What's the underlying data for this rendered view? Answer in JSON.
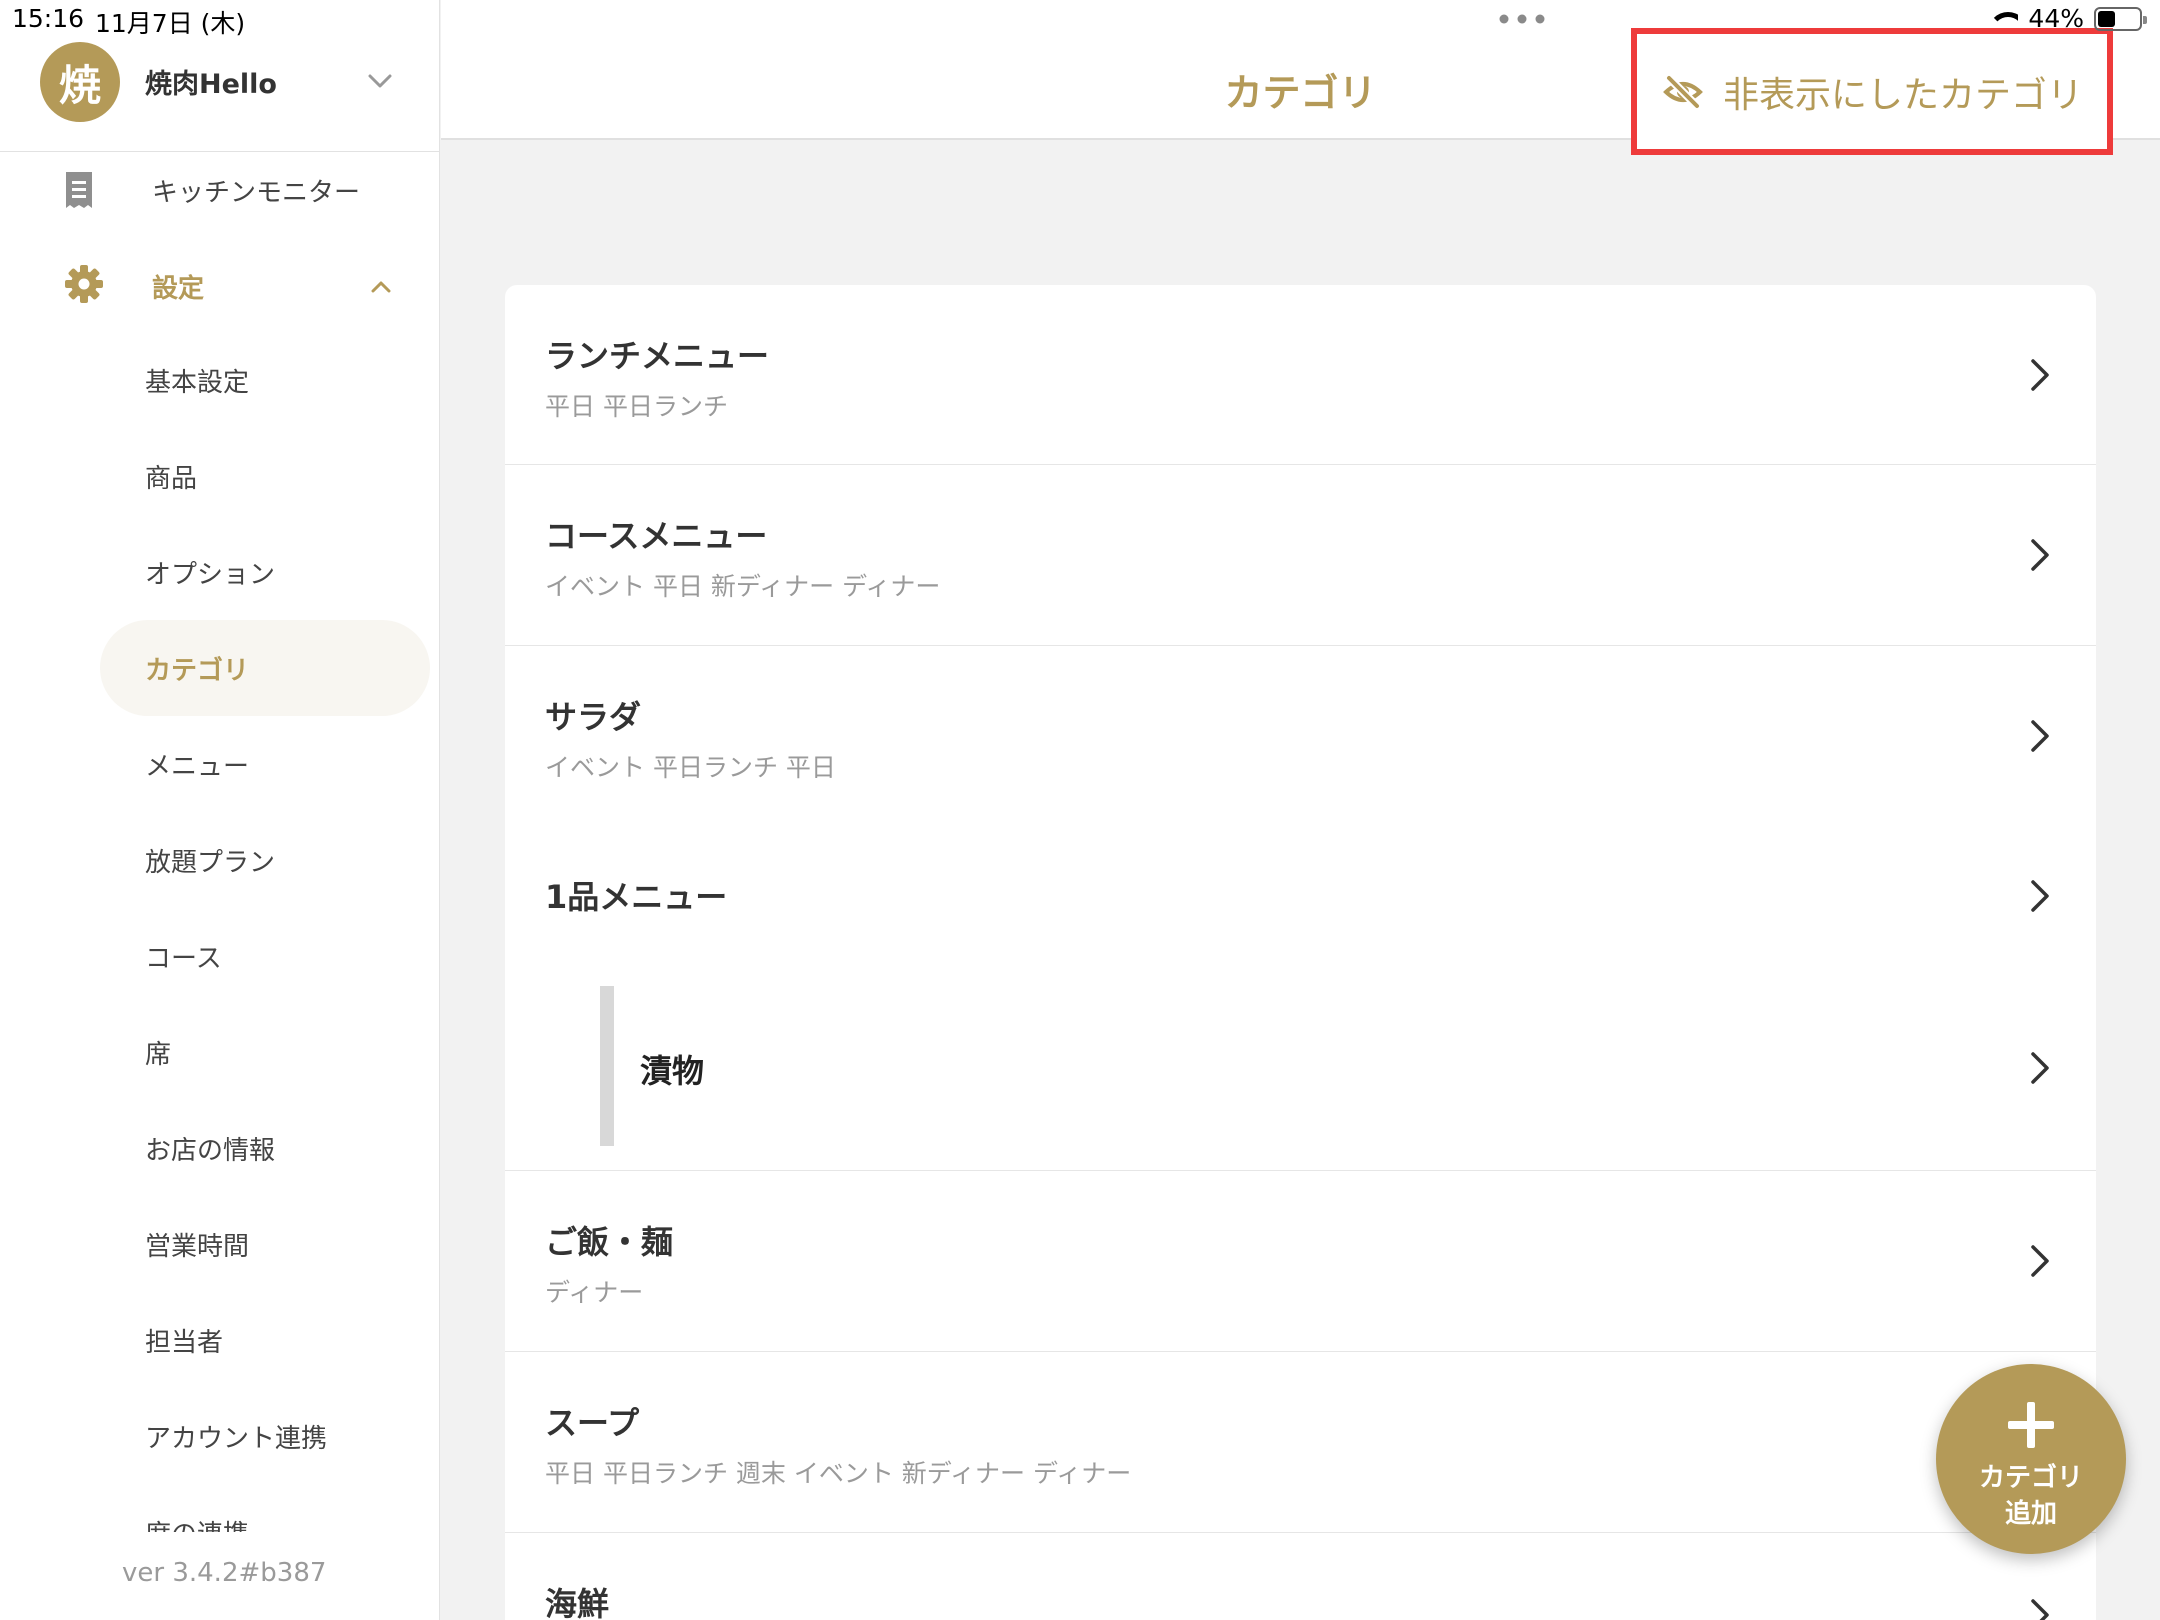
{
  "status_bar": {
    "time": "15:16",
    "date": "11月7日 (木)",
    "battery": "44%"
  },
  "store": {
    "avatar_char": "焼",
    "name": "焼肉Hello"
  },
  "sidebar": {
    "kitchen_label": "キッチンモニター",
    "settings_label": "設定",
    "sub_items": [
      {
        "label": "基本設定"
      },
      {
        "label": "商品"
      },
      {
        "label": "オプション"
      },
      {
        "label": "カテゴリ"
      },
      {
        "label": "メニュー"
      },
      {
        "label": "放題プラン"
      },
      {
        "label": "コース"
      },
      {
        "label": "席"
      },
      {
        "label": "お店の情報"
      },
      {
        "label": "営業時間"
      },
      {
        "label": "担当者"
      },
      {
        "label": "アカウント連携"
      },
      {
        "label": "席の連携"
      }
    ],
    "version": "ver 3.4.2#b387"
  },
  "header": {
    "title": "カテゴリ",
    "hidden_button_label": "非表示にしたカテゴリ"
  },
  "categories": [
    {
      "name": "ランチメニュー",
      "tags": "平日 平日ランチ"
    },
    {
      "name": "コースメニュー",
      "tags": "イベント 平日 新ディナー ディナー"
    },
    {
      "name": "サラダ",
      "tags": "イベント 平日ランチ 平日"
    },
    {
      "name": "1品メニュー",
      "tags": ""
    },
    {
      "name": "漬物",
      "tags": ""
    },
    {
      "name": "ご飯・麺",
      "tags": "ディナー"
    },
    {
      "name": "スープ",
      "tags": "平日 平日ランチ 週末 イベント 新ディナー ディナー"
    },
    {
      "name": "海鮮",
      "tags": ""
    }
  ],
  "fab": {
    "label_line1": "カテゴリ",
    "label_line2": "追加"
  },
  "colors": {
    "accent": "#b49a58",
    "highlight_border": "#ee3b3b"
  }
}
